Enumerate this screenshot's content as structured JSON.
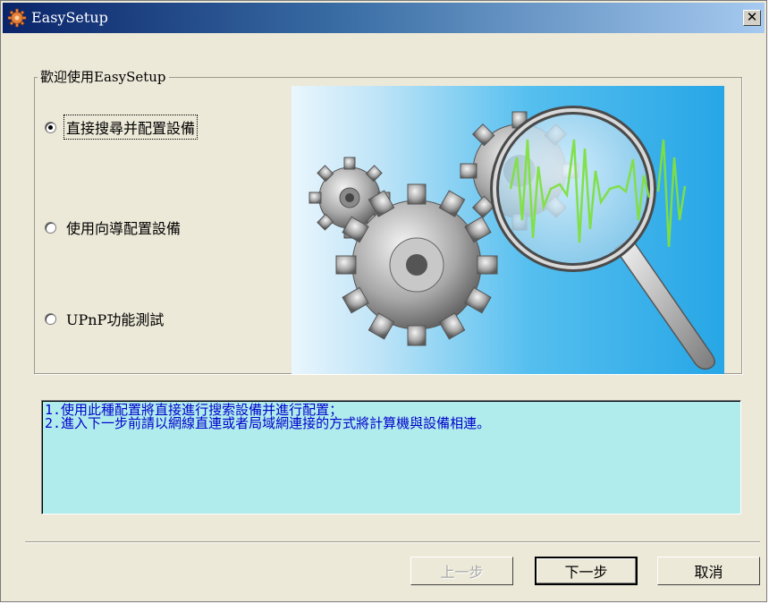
{
  "window": {
    "title": "EasySetup",
    "close_label": "✕",
    "icon": "gear-icon"
  },
  "group": {
    "label": "歡迎使用EasySetup"
  },
  "options": [
    {
      "label": "直接搜尋并配置設備",
      "selected": true
    },
    {
      "label": "使用向導配置設備",
      "selected": false
    },
    {
      "label": "UPnP功能測試",
      "selected": false
    }
  ],
  "illustration": {
    "icon": "gears-magnifier-icon"
  },
  "info": {
    "line1": "1.使用此種配置將直接進行搜索設備并進行配置；",
    "line2": "2.進入下一步前請以網線直連或者局域網連接的方式將計算機與設備相連。"
  },
  "buttons": {
    "prev": "上一步",
    "next": "下一步",
    "cancel": "取消"
  },
  "colors": {
    "titlebar_start": "#0a246a",
    "info_bg": "#b0ecec",
    "info_text": "#0000cc",
    "illustration_blue": "#27a6e6"
  }
}
